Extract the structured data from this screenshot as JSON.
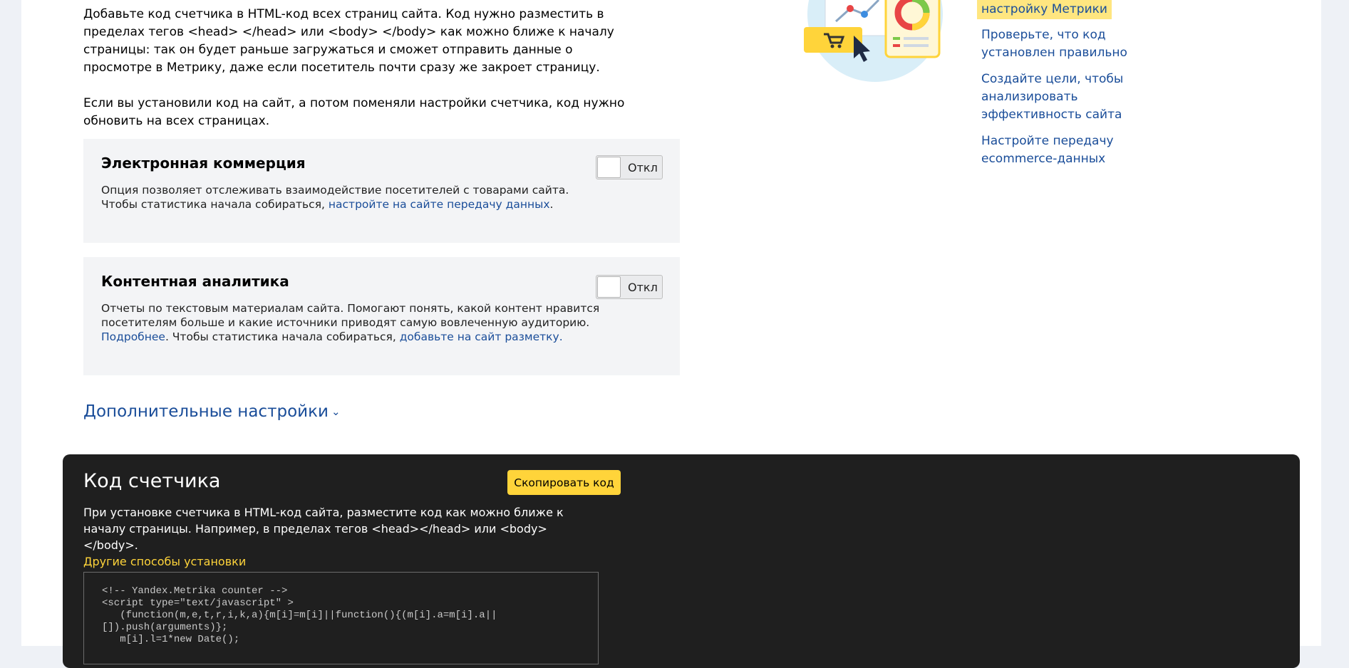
{
  "intro": {
    "p1": "Добавьте код счетчика в HTML-код всех страниц сайта. Код нужно разместить в пределах тегов <head> </head> или <body> </body> как можно ближе к началу страницы: так он будет раньше загружаться и сможет отправить данные о просмотре в Метрику, даже если посетитель почти сразу же закроет страницу.",
    "p2": "Если вы установили код на сайт, а потом поменяли настройки счетчика, код нужно обновить на всех страницах."
  },
  "ecommerce": {
    "title": "Электронная коммерция",
    "toggle_label": "Откл",
    "desc_line1": "Опция позволяет отслеживать взаимодействие посетителей с товарами сайта.",
    "desc_line2_prefix": "Чтобы статистика начала собираться, ",
    "desc_link": "настройте на сайте передачу данных",
    "desc_suffix": "."
  },
  "content_analytics": {
    "title": "Контентная аналитика",
    "toggle_label": "Откл",
    "desc_text": "Отчеты по текстовым материалам сайта. Помогают понять, какой контент нравится посетителям больше и какие источники приводят самую вовлеченную аудиторию.",
    "more_link": "Подробнее",
    "middle_text": ". Чтобы статистика начала собираться, ",
    "markup_link": "добавьте на сайт разметку."
  },
  "advanced": {
    "label": "Дополнительные настройки",
    "chevron": "⌄"
  },
  "counter_code": {
    "title": "Код счетчика",
    "copy_button": "Скопировать код",
    "desc": "При установке счетчика в HTML-код сайта, разместите код как можно ближе к началу страницы. Например, в пределах тегов <head></head> или <body></body>.",
    "other_methods_link": "Другие способы установки",
    "code": "<!-- Yandex.Metrika counter -->\n<script type=\"text/javascript\" >\n   (function(m,e,t,r,i,k,a){m[i]=m[i]||function(){(m[i].a=m[i].a||\n[]).push(arguments)};\n   m[i].l=1*new Date();"
  },
  "sidebar": {
    "highlight_link": "настройку Метрики",
    "links": [
      "Проверьте, что код установлен правильно",
      "Создайте цели, чтобы анализировать эффективность сайта",
      "Настройте передачу ecommerce-данных"
    ]
  },
  "colors": {
    "accent_yellow": "#ffd43a",
    "link_blue": "#1a4d99",
    "dark_panel": "#1f1f1f"
  }
}
